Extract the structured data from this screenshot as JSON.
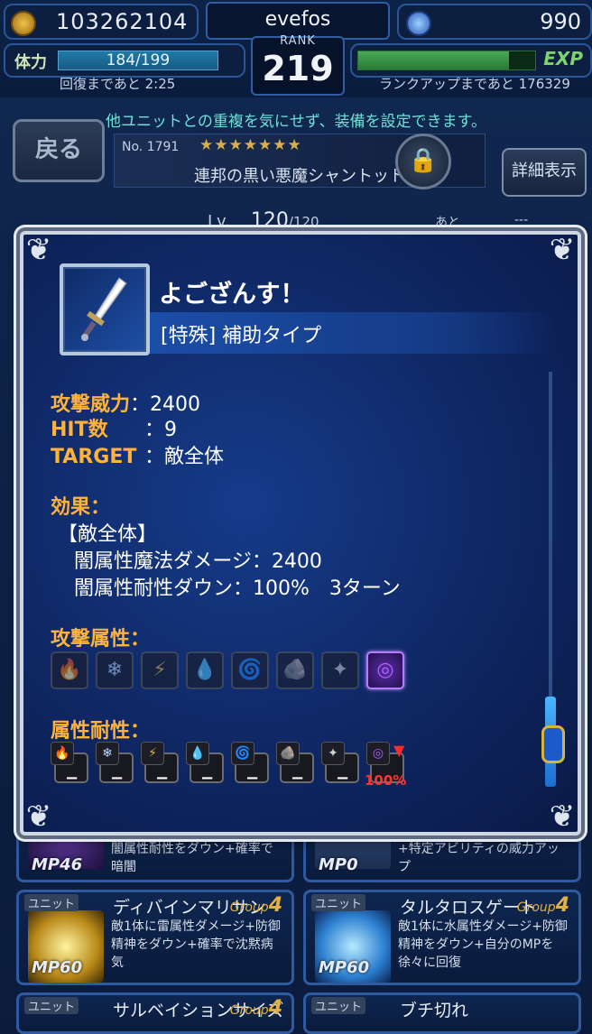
{
  "status": {
    "gil": "103262104",
    "player_name": "evefos",
    "rank_label": "RANK",
    "rank": "219",
    "crystals": "990",
    "stamina_label": "体力",
    "stamina": "184/199",
    "stamina_ratio": 0.925,
    "recovery_label": "回復まであと 2:25",
    "exp_label": "EXP",
    "exp_ratio": 0.85,
    "rankup_label": "ランクアップまであと 176329"
  },
  "background": {
    "notice": "他ユニットとの重複を気にせず、装備を設定できます。",
    "back_label": "戻る",
    "unit_no": "No. 1791",
    "unit_stars": "★★★★★★★",
    "unit_name": "連邦の黒い悪魔シャントット",
    "detail_label": "詳細表示",
    "lv_label": "Lv.",
    "lv_value": "120",
    "lv_max": "/120",
    "ato_label": "あと",
    "ato_value": "---",
    "cards": [
      {
        "tag": "",
        "mp": "MP46",
        "title": "",
        "group": "",
        "desc": "闇属性耐性をダウン+確率で暗闇"
      },
      {
        "tag": "",
        "mp": "MP0",
        "title": "",
        "group": "",
        "desc": "+特定アビリティの威力アップ"
      },
      {
        "tag": "ユニット",
        "mp": "MP60",
        "title": "ディバインマリサン",
        "group_label": "Group",
        "group_num": "4",
        "desc": "敵1体に雷属性ダメージ+防御精神をダウン+確率で沈黙病気"
      },
      {
        "tag": "ユニット",
        "mp": "MP60",
        "title": "タルタロスゲート",
        "group_label": "Group",
        "group_num": "4",
        "desc": "敵1体に水属性ダメージ+防御精神をダウン+自分のMPを徐々に回復"
      },
      {
        "tag": "ユニット",
        "title": "サルベイションサイズ",
        "group_label": "Group",
        "group_num": "4"
      },
      {
        "tag": "ユニット",
        "title": "ブチ切れ"
      }
    ]
  },
  "dialog": {
    "title": "よござんす！",
    "type": "[特殊] 補助タイプ",
    "stats": [
      {
        "label": "攻撃威力",
        "sep": "：",
        "value": "2400"
      },
      {
        "label": "HIT数",
        "sep": "：",
        "value": "9"
      },
      {
        "label": "TARGET",
        "sep": "：",
        "value": "敵全体"
      }
    ],
    "effect_label": "効果：",
    "effect_target": "【敵全体】",
    "effect_lines": [
      "闇属性魔法ダメージ：2400",
      "闇属性耐性ダウン：100%　3ターン"
    ],
    "attack_element_label": "攻撃属性：",
    "attack_elements": [
      "fire",
      "ice",
      "thunder",
      "water",
      "wind",
      "earth",
      "light",
      "dark"
    ],
    "attack_element_active": "dark",
    "resist_label": "属性耐性：",
    "resists": [
      {
        "element": "fire",
        "value": "−"
      },
      {
        "element": "ice",
        "value": "−"
      },
      {
        "element": "thunder",
        "value": "−"
      },
      {
        "element": "water",
        "value": "−"
      },
      {
        "element": "wind",
        "value": "−"
      },
      {
        "element": "earth",
        "value": "−"
      },
      {
        "element": "light",
        "value": "−"
      },
      {
        "element": "dark",
        "value": "100%"
      }
    ]
  },
  "icons": {
    "gil": "gil-coin-icon",
    "crystal": "lapis-crystal-icon",
    "lock": "lock-icon",
    "weapon": "dagger-icon"
  }
}
